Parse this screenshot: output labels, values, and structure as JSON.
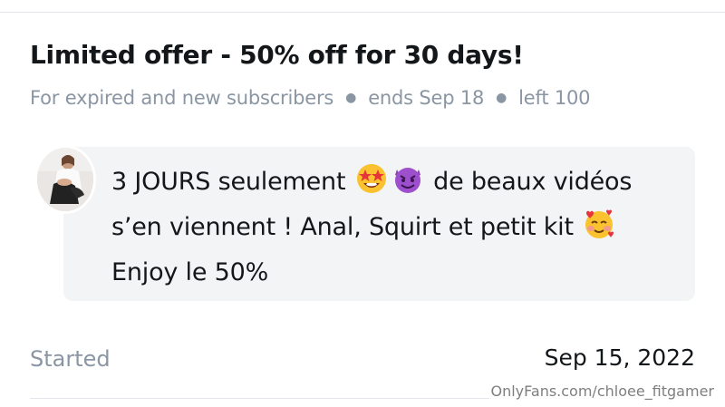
{
  "offer": {
    "title": "Limited offer - 50% off for 30 days!",
    "audience": "For expired and new subscribers",
    "ends": "ends Sep 18",
    "left": "left 100"
  },
  "message": {
    "part1": "3 JOURS seulement",
    "part2": "de beaux vidéos s’en viennent ! Anal, Squirt et petit kit",
    "part3": "Enjoy le 50%",
    "emojis": [
      "star-struck-emoji",
      "smiling-devil-emoji",
      "smiling-face-with-hearts-emoji"
    ]
  },
  "started": {
    "label": "Started",
    "date": "Sep 15, 2022"
  },
  "watermark": "OnlyFans.com/chloee_fitgamer",
  "colors": {
    "text_primary": "#14171a",
    "text_muted": "#8a96a3",
    "bubble_bg": "#f2f4f6"
  }
}
